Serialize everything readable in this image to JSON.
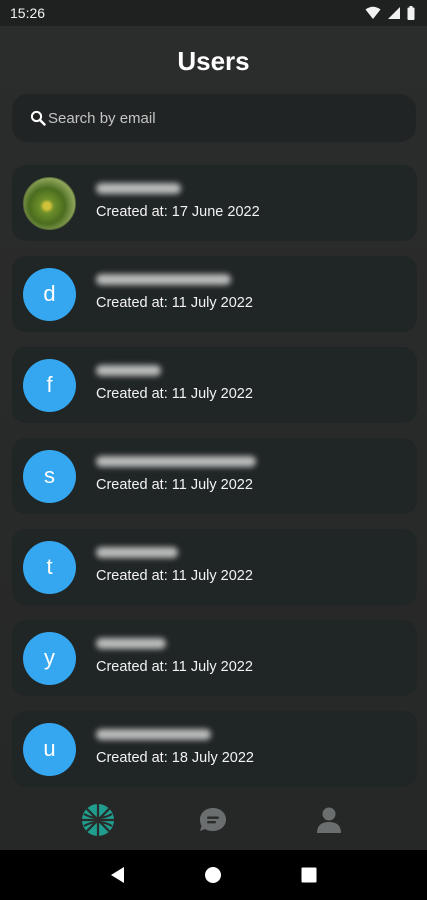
{
  "status_bar": {
    "time": "15:26"
  },
  "header": {
    "title": "Users"
  },
  "search": {
    "placeholder": "Search by email",
    "value": ""
  },
  "users": [
    {
      "initial": "",
      "avatar_type": "photo",
      "created": "Created at: 17 June 2022",
      "email_blur_width": 85
    },
    {
      "initial": "d",
      "avatar_type": "letter",
      "created": "Created at: 11 July 2022",
      "email_blur_width": 135
    },
    {
      "initial": "f",
      "avatar_type": "letter",
      "created": "Created at: 11 July 2022",
      "email_blur_width": 65
    },
    {
      "initial": "s",
      "avatar_type": "letter",
      "created": "Created at: 11 July 2022",
      "email_blur_width": 160
    },
    {
      "initial": "t",
      "avatar_type": "letter",
      "created": "Created at: 11 July 2022",
      "email_blur_width": 82
    },
    {
      "initial": "y",
      "avatar_type": "letter",
      "created": "Created at: 11 July 2022",
      "email_blur_width": 70
    },
    {
      "initial": "u",
      "avatar_type": "letter",
      "created": "Created at: 18 July 2022",
      "email_blur_width": 115
    }
  ],
  "bottom_nav": {
    "items": [
      {
        "name": "home-logo-icon",
        "active": true
      },
      {
        "name": "chat-icon",
        "active": false
      },
      {
        "name": "profile-icon",
        "active": false
      }
    ]
  },
  "colors": {
    "background": "#2a2b2b",
    "card": "#202525",
    "avatar": "#35a7f0",
    "accent": "#1f9e8f",
    "inactive_icon": "#6b6e6e"
  }
}
